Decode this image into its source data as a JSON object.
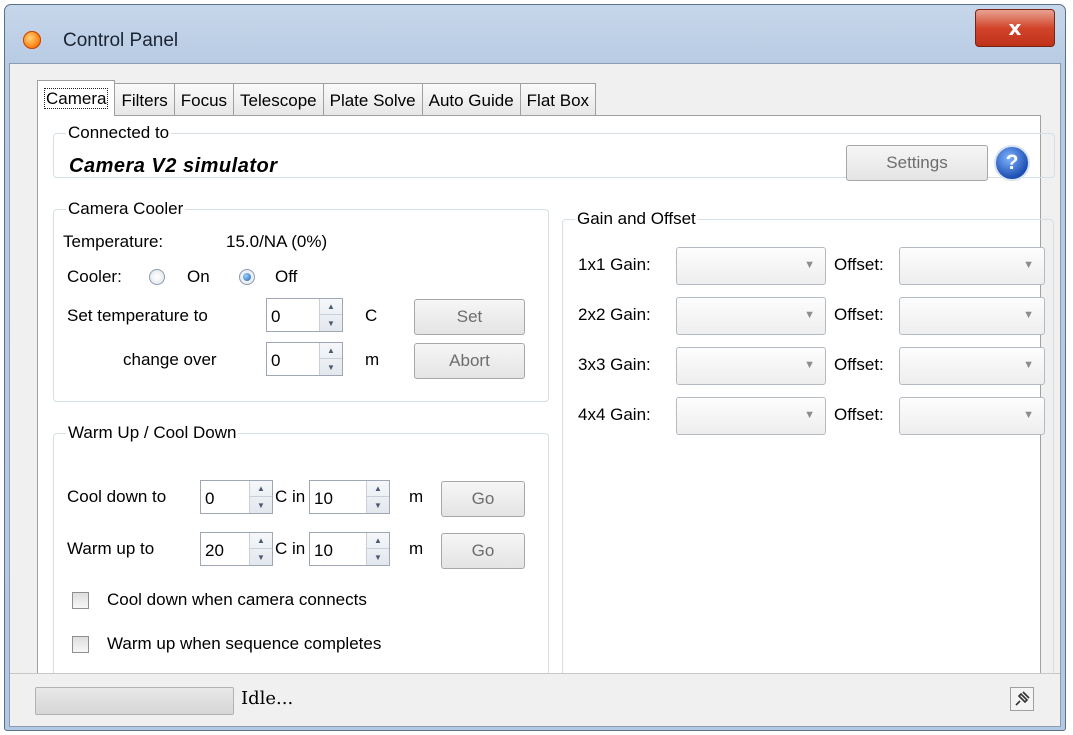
{
  "window": {
    "title": "Control Panel",
    "close_glyph": "x"
  },
  "tabs": [
    {
      "label": "Camera",
      "active": true
    },
    {
      "label": "Filters"
    },
    {
      "label": "Focus"
    },
    {
      "label": "Telescope"
    },
    {
      "label": "Plate Solve"
    },
    {
      "label": "Auto Guide"
    },
    {
      "label": "Flat Box"
    }
  ],
  "connected": {
    "legend": "Connected to",
    "device_name": "Camera V2 simulator",
    "settings_label": "Settings",
    "help_glyph": "?"
  },
  "cooler": {
    "legend": "Camera Cooler",
    "temperature_label": "Temperature:",
    "temperature_value": "15.0/NA (0%)",
    "cooler_label": "Cooler:",
    "on_label": "On",
    "off_label": "Off",
    "selected": "Off",
    "set_temp_label": "Set temperature to",
    "set_temp_value": "0",
    "set_temp_unit": "C",
    "set_button": "Set",
    "change_over_label": "change over",
    "change_over_value": "0",
    "change_over_unit": "m",
    "abort_button": "Abort"
  },
  "warmcool": {
    "legend": "Warm Up / Cool Down",
    "cool_label": "Cool down to",
    "cool_temp": "0",
    "cool_minutes": "10",
    "warm_label": "Warm up to",
    "warm_temp": "20",
    "warm_minutes": "10",
    "c_in": "C in",
    "m": "m",
    "go": "Go",
    "cool_on_connect": "Cool down when camera connects",
    "warm_on_complete": "Warm up when sequence completes"
  },
  "gain": {
    "legend": "Gain and Offset",
    "offset_label": "Offset:",
    "rows": [
      {
        "label": "1x1 Gain:"
      },
      {
        "label": "2x2 Gain:"
      },
      {
        "label": "3x3 Gain:"
      },
      {
        "label": "4x4 Gain:"
      }
    ]
  },
  "status": {
    "text": "Idle..."
  },
  "colors": {
    "accent": "#1d4fb3",
    "close": "#c0311a",
    "window_frame": "#b7cbe3"
  }
}
